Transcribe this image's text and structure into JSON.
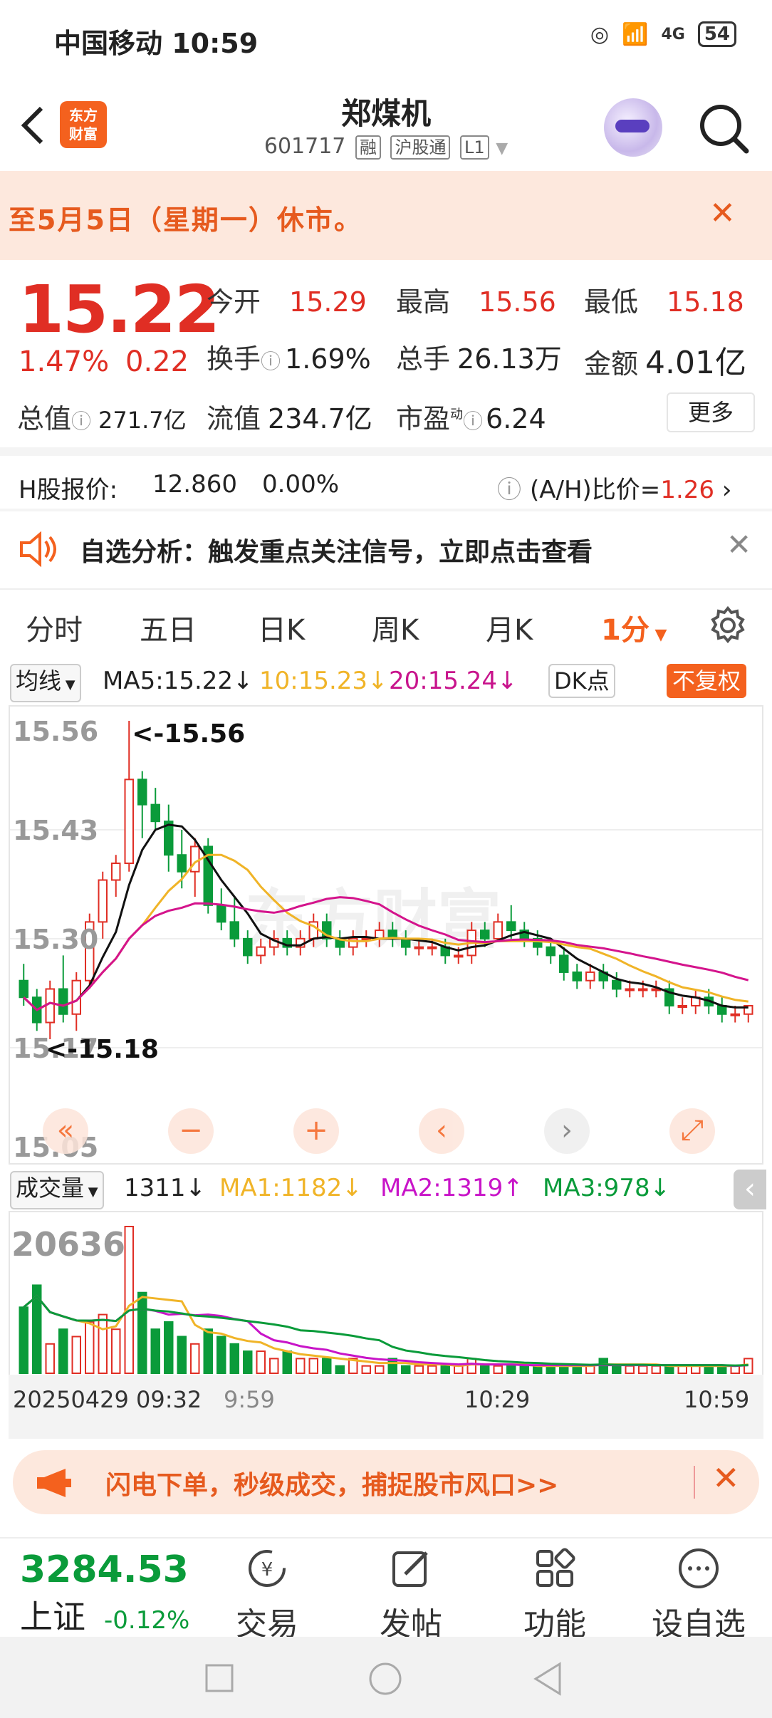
{
  "status_bar": {
    "carrier_time": "中国移动 10:59",
    "network": "4G",
    "battery": "54"
  },
  "header": {
    "logo_line1": "东方",
    "logo_line2": "财富",
    "title": "郑煤机",
    "code": "601717",
    "tags": [
      "融",
      "沪股通",
      "L1"
    ]
  },
  "notice": {
    "text": "至5月5日（星期一）休市。"
  },
  "quote": {
    "price": "15.22",
    "change_pct": "1.47%",
    "change_amt": "0.22",
    "open_label": "今开",
    "open": "15.29",
    "high_label": "最高",
    "high": "15.56",
    "low_label": "最低",
    "low": "15.18",
    "turnover_label": "换手",
    "turnover": "1.69%",
    "volume_label": "总手",
    "volume": "26.13万",
    "amount_label": "金额",
    "amount": "4.01亿",
    "mktcap_label": "总值",
    "mktcap": "271.7亿",
    "float_label": "流值",
    "float": "234.7亿",
    "pe_label": "市盈",
    "pe_sup": "动",
    "pe": "6.24",
    "more_label": "更多"
  },
  "h_share": {
    "label": "H股报价:",
    "price": "12.860",
    "pct": "0.00%",
    "ah_label": "(A/H)比价=",
    "ah_value": "1.26"
  },
  "alert": {
    "text": "自选分析：触发重点关注信号，立即点击查看"
  },
  "tabs": [
    {
      "label": "分时"
    },
    {
      "label": "五日"
    },
    {
      "label": "日K"
    },
    {
      "label": "周K"
    },
    {
      "label": "月K"
    },
    {
      "label": "1分"
    }
  ],
  "ma_legend": {
    "selector": "均线",
    "ma5": "MA5:15.22",
    "ma10": "10:15.23",
    "ma20": "20:15.24",
    "dk": "DK点",
    "fuquan": "不复权"
  },
  "chart_data": {
    "type": "candlestick",
    "y_ticks": [
      "15.56",
      "15.43",
      "15.30",
      "15.17",
      "15.05"
    ],
    "ylim": [
      15.05,
      15.56
    ],
    "high_annotation": "<-15.56",
    "low_annotation": "<-15.18",
    "ma_colors": {
      "ma5": "#111111",
      "ma10": "#f0b428",
      "ma20": "#d4148c"
    },
    "candles": [
      [
        15.25,
        15.27,
        15.22,
        15.23
      ],
      [
        15.23,
        15.24,
        15.19,
        15.2
      ],
      [
        15.2,
        15.25,
        15.18,
        15.24
      ],
      [
        15.24,
        15.28,
        15.2,
        15.21
      ],
      [
        15.21,
        15.26,
        15.19,
        15.25
      ],
      [
        15.25,
        15.33,
        15.24,
        15.32
      ],
      [
        15.32,
        15.38,
        15.3,
        15.37
      ],
      [
        15.37,
        15.4,
        15.35,
        15.39
      ],
      [
        15.39,
        15.56,
        15.38,
        15.49
      ],
      [
        15.49,
        15.5,
        15.42,
        15.46
      ],
      [
        15.46,
        15.48,
        15.43,
        15.44
      ],
      [
        15.44,
        15.46,
        15.38,
        15.4
      ],
      [
        15.4,
        15.43,
        15.36,
        15.38
      ],
      [
        15.38,
        15.42,
        15.35,
        15.41
      ],
      [
        15.41,
        15.42,
        15.33,
        15.34
      ],
      [
        15.34,
        15.36,
        15.31,
        15.32
      ],
      [
        15.32,
        15.35,
        15.29,
        15.3
      ],
      [
        15.3,
        15.31,
        15.27,
        15.28
      ],
      [
        15.28,
        15.3,
        15.27,
        15.29
      ],
      [
        15.29,
        15.31,
        15.28,
        15.3
      ],
      [
        15.3,
        15.31,
        15.28,
        15.29
      ],
      [
        15.29,
        15.31,
        15.28,
        15.3
      ],
      [
        15.3,
        15.33,
        15.29,
        15.32
      ],
      [
        15.32,
        15.33,
        15.29,
        15.3
      ],
      [
        15.3,
        15.31,
        15.28,
        15.29
      ],
      [
        15.29,
        15.31,
        15.28,
        15.3
      ],
      [
        15.3,
        15.31,
        15.29,
        15.3
      ],
      [
        15.3,
        15.32,
        15.29,
        15.31
      ],
      [
        15.31,
        15.32,
        15.29,
        15.3
      ],
      [
        15.3,
        15.31,
        15.28,
        15.29
      ],
      [
        15.29,
        15.3,
        15.28,
        15.29
      ],
      [
        15.29,
        15.3,
        15.28,
        15.29
      ],
      [
        15.29,
        15.3,
        15.27,
        15.28
      ],
      [
        15.28,
        15.29,
        15.27,
        15.28
      ],
      [
        15.28,
        15.32,
        15.27,
        15.31
      ],
      [
        15.31,
        15.32,
        15.29,
        15.3
      ],
      [
        15.3,
        15.33,
        15.3,
        15.32
      ],
      [
        15.32,
        15.34,
        15.3,
        15.31
      ],
      [
        15.31,
        15.32,
        15.29,
        15.3
      ],
      [
        15.3,
        15.31,
        15.28,
        15.29
      ],
      [
        15.29,
        15.3,
        15.27,
        15.28
      ],
      [
        15.28,
        15.29,
        15.25,
        15.26
      ],
      [
        15.26,
        15.27,
        15.24,
        15.25
      ],
      [
        15.25,
        15.27,
        15.24,
        15.26
      ],
      [
        15.26,
        15.27,
        15.24,
        15.25
      ],
      [
        15.25,
        15.26,
        15.23,
        15.24
      ],
      [
        15.24,
        15.25,
        15.23,
        15.24
      ],
      [
        15.24,
        15.25,
        15.23,
        15.24
      ],
      [
        15.24,
        15.25,
        15.23,
        15.24
      ],
      [
        15.24,
        15.25,
        15.21,
        15.22
      ],
      [
        15.22,
        15.23,
        15.21,
        15.22
      ],
      [
        15.22,
        15.24,
        15.21,
        15.23
      ],
      [
        15.23,
        15.24,
        15.21,
        15.22
      ],
      [
        15.22,
        15.23,
        15.2,
        15.21
      ],
      [
        15.21,
        15.22,
        15.2,
        15.21
      ],
      [
        15.21,
        15.22,
        15.2,
        15.22
      ]
    ]
  },
  "chart_controls": {
    "first": "«",
    "zoom_out": "−",
    "zoom_in": "+",
    "prev": "‹",
    "next": "›",
    "fullscreen": "⤢"
  },
  "vol_legend": {
    "selector": "成交量",
    "vol": "1311",
    "ma1": "MA1:1182",
    "ma2": "MA2:1319",
    "ma3": "MA3:978"
  },
  "vol_data": {
    "max_label": "20636",
    "bars": [
      9,
      12,
      4,
      6,
      5,
      7,
      8,
      6,
      20,
      11,
      6,
      7,
      5,
      4,
      6,
      5,
      4,
      3,
      3,
      2,
      3,
      2,
      2,
      2,
      1,
      2,
      1,
      1,
      2,
      1,
      1,
      1,
      1,
      1,
      2,
      1,
      1,
      1,
      1,
      1,
      1,
      1,
      1,
      1,
      2,
      1,
      1,
      1,
      1,
      1,
      1,
      1,
      1,
      1,
      1,
      2
    ]
  },
  "time_axis": {
    "start": "20250429 09:32",
    "mid_overlap": "9:59",
    "mid": "10:29",
    "end": "10:59"
  },
  "ad": {
    "text": "闪电下单，秒级成交，捕捉股市风口>>"
  },
  "bottom_nav": {
    "index_value": "3284.53",
    "index_name": "上证",
    "index_pct": "-0.12%",
    "items": [
      {
        "label": "交易"
      },
      {
        "label": "发帖"
      },
      {
        "label": "功能"
      },
      {
        "label": "设自选"
      }
    ]
  }
}
